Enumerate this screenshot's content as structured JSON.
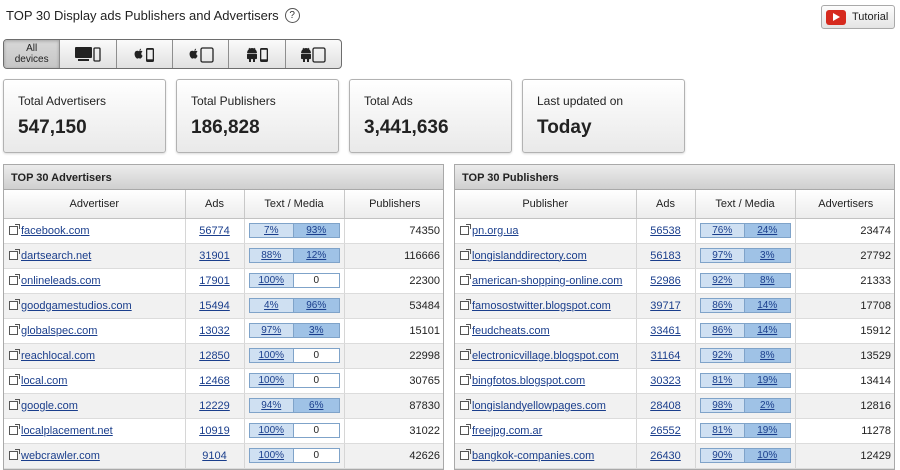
{
  "page": {
    "title": "TOP 30 Display ads Publishers and Advertisers",
    "help": "?",
    "tutorial_label": "Tutorial"
  },
  "devices": [
    {
      "label": "All devices",
      "icon": "all-devices-icon",
      "active": true
    },
    {
      "label": "",
      "icon": "desktop-icon"
    },
    {
      "label": "",
      "icon": "apple-phone-icon"
    },
    {
      "label": "",
      "icon": "apple-tablet-icon"
    },
    {
      "label": "",
      "icon": "android-phone-icon"
    },
    {
      "label": "",
      "icon": "android-tablet-icon"
    }
  ],
  "stats": [
    {
      "label": "Total Advertisers",
      "value": "547,150"
    },
    {
      "label": "Total Publishers",
      "value": "186,828"
    },
    {
      "label": "Total Ads",
      "value": "3,441,636"
    },
    {
      "label": "Last updated on",
      "value": "Today"
    }
  ],
  "advertisers": {
    "title": "TOP 30 Advertisers",
    "columns": [
      "Advertiser",
      "Ads",
      "Text / Media",
      "Publishers"
    ],
    "rows": [
      {
        "name": "facebook.com",
        "ads": "56774",
        "text": "7%",
        "media": "93%",
        "count": "74350"
      },
      {
        "name": "dartsearch.net",
        "ads": "31901",
        "text": "88%",
        "media": "12%",
        "count": "116666"
      },
      {
        "name": "onlineleads.com",
        "ads": "17901",
        "text": "100%",
        "media": "0",
        "count": "22300"
      },
      {
        "name": "goodgamestudios.com",
        "ads": "15494",
        "text": "4%",
        "media": "96%",
        "count": "53484"
      },
      {
        "name": "globalspec.com",
        "ads": "13032",
        "text": "97%",
        "media": "3%",
        "count": "15101"
      },
      {
        "name": "reachlocal.com",
        "ads": "12850",
        "text": "100%",
        "media": "0",
        "count": "22998"
      },
      {
        "name": "local.com",
        "ads": "12468",
        "text": "100%",
        "media": "0",
        "count": "30765"
      },
      {
        "name": "google.com",
        "ads": "12229",
        "text": "94%",
        "media": "6%",
        "count": "87830"
      },
      {
        "name": "localplacement.net",
        "ads": "10919",
        "text": "100%",
        "media": "0",
        "count": "31022"
      },
      {
        "name": "webcrawler.com",
        "ads": "9104",
        "text": "100%",
        "media": "0",
        "count": "42626"
      }
    ]
  },
  "publishers": {
    "title": "TOP 30 Publishers",
    "columns": [
      "Publisher",
      "Ads",
      "Text / Media",
      "Advertisers"
    ],
    "rows": [
      {
        "name": "pn.org.ua",
        "ads": "56538",
        "text": "76%",
        "media": "24%",
        "count": "23474"
      },
      {
        "name": "longislanddirectory.com",
        "ads": "56183",
        "text": "97%",
        "media": "3%",
        "count": "27792"
      },
      {
        "name": "american-shopping-online.com",
        "ads": "52986",
        "text": "92%",
        "media": "8%",
        "count": "21333"
      },
      {
        "name": "famosostwitter.blogspot.com",
        "ads": "39717",
        "text": "86%",
        "media": "14%",
        "count": "17708"
      },
      {
        "name": "feudcheats.com",
        "ads": "33461",
        "text": "86%",
        "media": "14%",
        "count": "15912"
      },
      {
        "name": "electronicvillage.blogspot.com",
        "ads": "31164",
        "text": "92%",
        "media": "8%",
        "count": "13529"
      },
      {
        "name": "bingfotos.blogspot.com",
        "ads": "30323",
        "text": "81%",
        "media": "19%",
        "count": "13414"
      },
      {
        "name": "longislandyellowpages.com",
        "ads": "28408",
        "text": "98%",
        "media": "2%",
        "count": "12816"
      },
      {
        "name": "freejpg.com.ar",
        "ads": "26552",
        "text": "81%",
        "media": "19%",
        "count": "11278"
      },
      {
        "name": "bangkok-companies.com",
        "ads": "26430",
        "text": "90%",
        "media": "10%",
        "count": "12429"
      }
    ]
  }
}
